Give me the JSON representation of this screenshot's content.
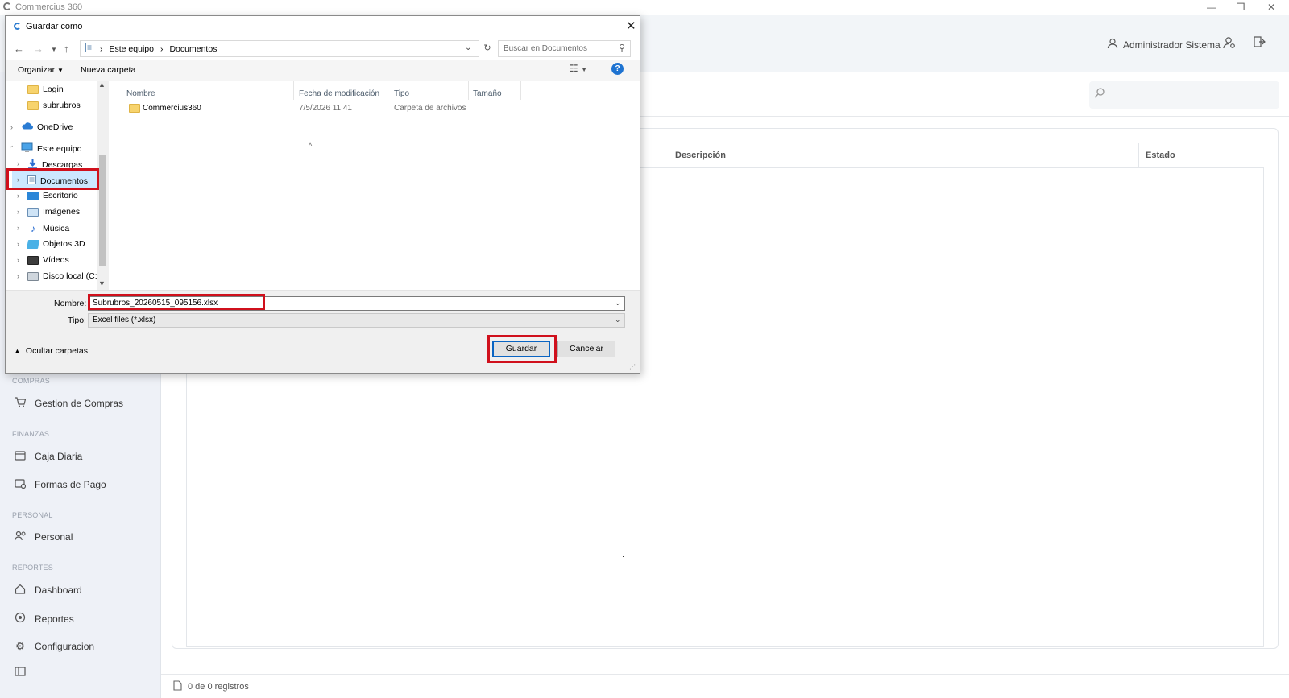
{
  "app": {
    "title": "Commercius 360",
    "user_name": "Administrador Sistema",
    "window_controls": [
      "minimize-icon",
      "restore-icon",
      "close-icon"
    ]
  },
  "grid": {
    "columns": [
      "Descripción",
      "Estado"
    ],
    "footer": "0 de 0 registros"
  },
  "sidebar": {
    "sections": [
      {
        "title": "COMPRAS",
        "items": [
          {
            "label": "Gestion de Compras",
            "icon": "cart-icon"
          }
        ]
      },
      {
        "title": "FINANZAS",
        "items": [
          {
            "label": "Caja Diaria",
            "icon": "cash-register-icon"
          },
          {
            "label": "Formas de Pago",
            "icon": "payment-icon"
          }
        ]
      },
      {
        "title": "PERSONAL",
        "items": [
          {
            "label": "Personal",
            "icon": "users-icon"
          }
        ]
      },
      {
        "title": "REPORTES",
        "items": [
          {
            "label": "Dashboard",
            "icon": "home-icon"
          },
          {
            "label": "Reportes",
            "icon": "reports-icon"
          },
          {
            "label": "Configuracion",
            "icon": "gear-icon"
          }
        ]
      }
    ]
  },
  "dialog": {
    "title": "Guardar como",
    "breadcrumb": [
      "Este equipo",
      "Documentos"
    ],
    "search_placeholder": "Buscar en Documentos",
    "toolbar": {
      "organize": "Organizar",
      "new_folder": "Nueva carpeta"
    },
    "tree": [
      {
        "label": "Login",
        "icon": "folder-icon"
      },
      {
        "label": "subrubros",
        "icon": "folder-icon"
      },
      {
        "label": "OneDrive",
        "icon": "cloud-icon"
      },
      {
        "label": "Este equipo",
        "icon": "computer-icon"
      },
      {
        "label": "Descargas",
        "icon": "download-icon"
      },
      {
        "label": "Documentos",
        "icon": "documents-icon",
        "selected": true
      },
      {
        "label": "Escritorio",
        "icon": "desktop-icon"
      },
      {
        "label": "Imágenes",
        "icon": "pictures-icon"
      },
      {
        "label": "Música",
        "icon": "music-icon"
      },
      {
        "label": "Objetos 3D",
        "icon": "objects3d-icon"
      },
      {
        "label": "Vídeos",
        "icon": "videos-icon"
      },
      {
        "label": "Disco local (C:)",
        "icon": "drive-icon"
      }
    ],
    "columns": [
      "Nombre",
      "Fecha de modificación",
      "Tipo",
      "Tamaño"
    ],
    "files": [
      {
        "name": "Commercius360",
        "modified": "7/5/2026 11:41",
        "type": "Carpeta de archivos",
        "size": ""
      }
    ],
    "name_label": "Nombre:",
    "name_value": "Subrubros_20260515_095156.xlsx",
    "type_label": "Tipo:",
    "type_value": "Excel files (*.xlsx)",
    "hide_folders": "Ocultar carpetas",
    "save_label": "Guardar",
    "cancel_label": "Cancelar"
  },
  "colors": {
    "highlight": "#d0101c",
    "accent": "#0a64c2",
    "sidebar_bg": "#eef1f7"
  }
}
